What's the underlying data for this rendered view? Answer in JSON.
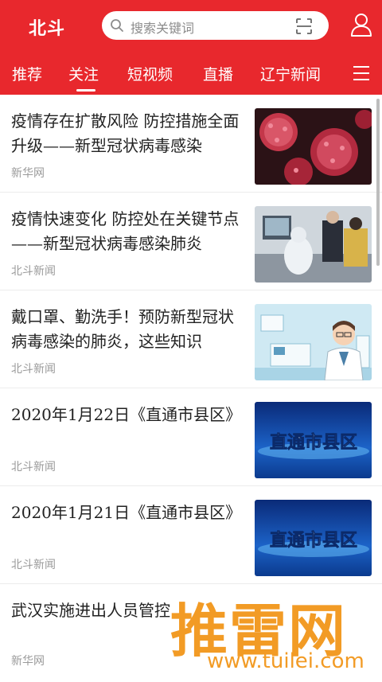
{
  "header": {
    "logo": "北斗",
    "search_placeholder": "搜索关键词",
    "brand_color": "#e8282d"
  },
  "tabs": [
    {
      "label": "推荐"
    },
    {
      "label": "关注",
      "active": true
    },
    {
      "label": "短视频"
    },
    {
      "label": "直播"
    },
    {
      "label": "辽宁新闻"
    }
  ],
  "feed": [
    {
      "title": "疫情存在扩散风险 防控措施全面升级——新型冠状病毒感染",
      "source": "新华网",
      "thumb": "virus-image"
    },
    {
      "title": "疫情快速变化 防控处在关键节点——新型冠状病毒感染肺炎",
      "source": "北斗新闻",
      "thumb": "lab-workers-image"
    },
    {
      "title": "戴口罩、勤洗手！预防新型冠状病毒感染的肺炎，这些知识",
      "source": "北斗新闻",
      "thumb": "doctor-illustration"
    },
    {
      "title": "2020年1月22日《直通市县区》",
      "source": "北斗新闻",
      "thumb": "tv-program-banner"
    },
    {
      "title": "2020年1月21日《直通市县区》",
      "source": "北斗新闻",
      "thumb": "tv-program-banner"
    },
    {
      "title": "武汉实施进出人员管控",
      "source": "新华网",
      "thumb": "none"
    }
  ],
  "thumb_text": "直通市县区",
  "watermark": {
    "main": "推雷网",
    "sub": "www.tuilei.com"
  }
}
